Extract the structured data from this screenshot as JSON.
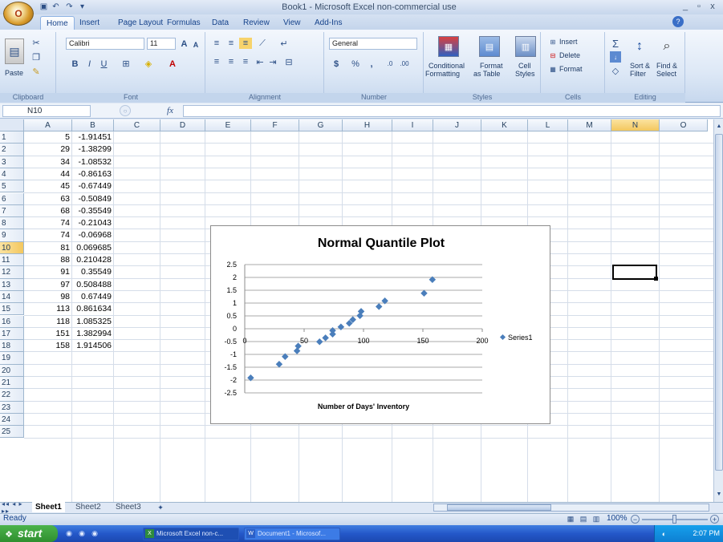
{
  "window": {
    "title": "Book1 - Microsoft Excel non-commercial use",
    "office_button": "O",
    "controls": [
      "_",
      "▫",
      "x"
    ]
  },
  "ribbon_tabs": [
    "Home",
    "Insert",
    "Page Layout",
    "Formulas",
    "Data",
    "Review",
    "View",
    "Add-Ins"
  ],
  "ribbon": {
    "clipboard": {
      "paste": "Paste",
      "label": "Clipboard"
    },
    "font": {
      "name": "Calibri",
      "size": "11",
      "label": "Font",
      "bold": "B",
      "italic": "I",
      "underline": "U"
    },
    "alignment": {
      "label": "Alignment"
    },
    "number": {
      "format": "General",
      "label": "Number",
      "currency": "$",
      "percent": "%",
      "comma": ","
    },
    "styles": {
      "conditional": "Conditional",
      "conditional2": "Formatting",
      "format_table": "Format",
      "format_table2": "as Table",
      "cell_styles": "Cell",
      "cell_styles2": "Styles",
      "label": "Styles"
    },
    "cells": {
      "insert": "Insert",
      "delete": "Delete",
      "format": "Format",
      "label": "Cells"
    },
    "editing": {
      "sort": "Sort &",
      "sort2": "Filter",
      "find": "Find &",
      "find2": "Select",
      "label": "Editing"
    }
  },
  "formula_bar": {
    "name_box": "N10",
    "fx": "fx",
    "value": ""
  },
  "columns": [
    "A",
    "B",
    "C",
    "D",
    "E",
    "F",
    "G",
    "H",
    "I",
    "J",
    "K",
    "L",
    "M",
    "N",
    "O"
  ],
  "rows": [
    "1",
    "2",
    "3",
    "4",
    "5",
    "6",
    "7",
    "8",
    "9",
    "10",
    "11",
    "12",
    "13",
    "14",
    "15",
    "16",
    "17",
    "18",
    "19",
    "20",
    "21",
    "22",
    "23",
    "24",
    "25"
  ],
  "cells": [
    [
      "5",
      "-1.91451"
    ],
    [
      "29",
      "-1.38299"
    ],
    [
      "34",
      "-1.08532"
    ],
    [
      "44",
      "-0.86163"
    ],
    [
      "45",
      "-0.67449"
    ],
    [
      "63",
      "-0.50849"
    ],
    [
      "68",
      "-0.35549"
    ],
    [
      "74",
      "-0.21043"
    ],
    [
      "74",
      "-0.06968"
    ],
    [
      "81",
      "0.069685"
    ],
    [
      "88",
      "0.210428"
    ],
    [
      "91",
      "0.35549"
    ],
    [
      "97",
      "0.508488"
    ],
    [
      "98",
      "0.67449"
    ],
    [
      "113",
      "0.861634"
    ],
    [
      "118",
      "1.085325"
    ],
    [
      "151",
      "1.382994"
    ],
    [
      "158",
      "1.914506"
    ]
  ],
  "chart_data": {
    "type": "scatter",
    "title": "Normal Quantile Plot",
    "xlabel": "Number of Days' Inventory",
    "ylabel": "",
    "xlim": [
      0,
      200
    ],
    "ylim": [
      -2.5,
      2.5
    ],
    "x_ticks": [
      "0",
      "50",
      "100",
      "150",
      "200"
    ],
    "y_ticks": [
      "2.5",
      "2",
      "1.5",
      "1",
      "0.5",
      "0",
      "-0.5",
      "-1",
      "-1.5",
      "-2",
      "-2.5"
    ],
    "grid": true,
    "legend": "right",
    "series": [
      {
        "name": "Series1",
        "color": "#4a7ebb",
        "points": [
          [
            5,
            -1.91451
          ],
          [
            29,
            -1.38299
          ],
          [
            34,
            -1.08532
          ],
          [
            44,
            -0.86163
          ],
          [
            45,
            -0.67449
          ],
          [
            63,
            -0.50849
          ],
          [
            68,
            -0.35549
          ],
          [
            74,
            -0.21043
          ],
          [
            74,
            -0.06968
          ],
          [
            81,
            0.069685
          ],
          [
            88,
            0.210428
          ],
          [
            91,
            0.35549
          ],
          [
            97,
            0.508488
          ],
          [
            98,
            0.67449
          ],
          [
            113,
            0.861634
          ],
          [
            118,
            1.085325
          ],
          [
            151,
            1.382994
          ],
          [
            158,
            1.914506
          ]
        ]
      }
    ]
  },
  "sheets": [
    "Sheet1",
    "Sheet2",
    "Sheet3"
  ],
  "status": {
    "left": "Ready",
    "zoom": "100%"
  },
  "taskbar": {
    "start": "start",
    "items": [
      "Microsoft Excel non-c...",
      "Document1 - Microsof..."
    ],
    "clock": "2:07 PM"
  }
}
